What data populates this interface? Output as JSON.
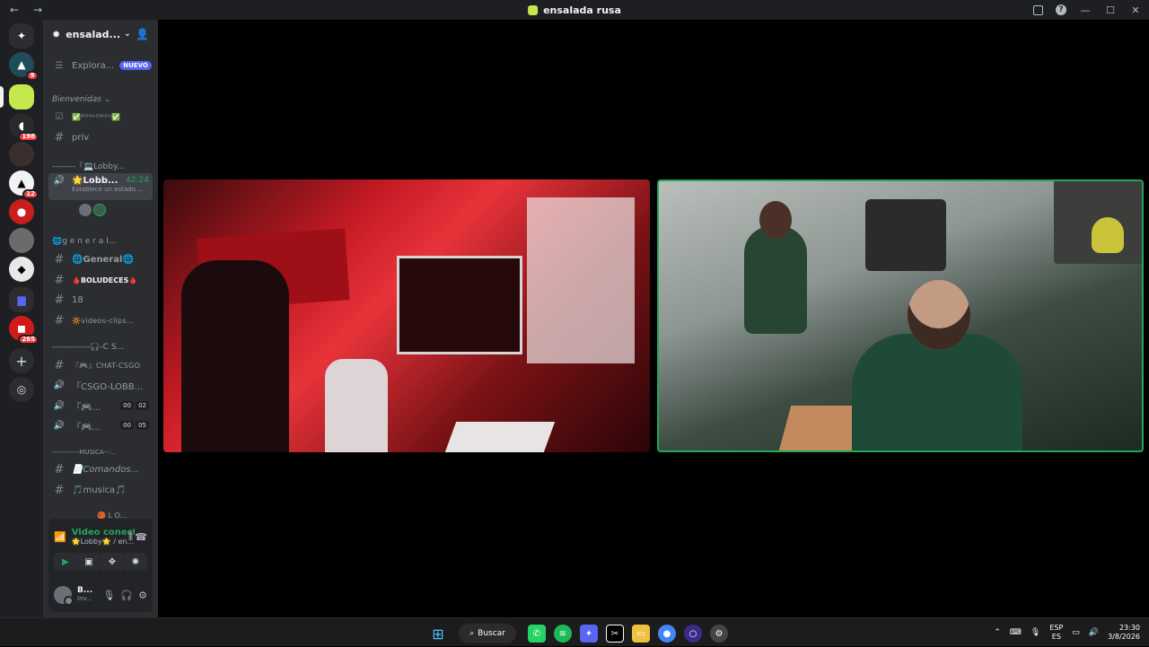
{
  "window": {
    "title": "ensalada rusa",
    "back": "←",
    "forward": "→"
  },
  "guilds": [
    {
      "name": "direct-messages",
      "icon": "discord-icon",
      "color": "#2b2d31"
    },
    {
      "name": "server-triangle",
      "badge": "9",
      "color": "#1f4c5a"
    },
    {
      "name": "server-ensalada",
      "color": "#c6e84f",
      "selected": true
    },
    {
      "name": "server-dark",
      "badge": "198",
      "color": "#2a2a2a"
    },
    {
      "name": "server-portrait",
      "color": "#3b2e2e"
    },
    {
      "name": "server-white",
      "badge": "12",
      "color": "#f2f3f5"
    },
    {
      "name": "server-red",
      "color": "#c81e1e"
    },
    {
      "name": "server-gray",
      "color": "#6b6b6b"
    },
    {
      "name": "server-penguin",
      "color": "#e8e8e8"
    },
    {
      "name": "folder",
      "color": "#5865f2"
    },
    {
      "name": "server-red-badge",
      "badge": "265",
      "color": "#d11b1b"
    }
  ],
  "server": {
    "name": "ensalad...",
    "explore_label": "Explora...",
    "explore_badge": "NUEVO"
  },
  "channels": {
    "cat_bienvenidas": "Bienvenidas ⌄",
    "ch_bienvenida": "✅ᴮᴵᴱᴺᵛᴱᴺᴵᴰᴬ✅",
    "ch_priv": "priv",
    "cat_lobby": "--------『💻Lobby...",
    "voice_lobby": "🌟Lobb...",
    "voice_lobby_time": "42:24",
    "voice_lobby_status": "Establece un estado ...",
    "cat_general": "🌐g e n e r a l...",
    "ch_general": "🌐General🌐",
    "ch_boludeces": "🩸BOLUDECES🩸",
    "ch_18": "18",
    "ch_videos": "🔆videos-clips...",
    "cat_csgo": "-------------🎧-C S...",
    "ch_chat_csgo": "『🎮』CHAT-CSGO",
    "voice_csgo_lobby": "『CSGO-LOBB...",
    "voice_a": "『🎮...",
    "voice_a_counts": [
      "00",
      "02"
    ],
    "voice_b": "『🎮...",
    "voice_b_counts": [
      "00",
      "05"
    ],
    "cat_musica": "------------MUSICA---...",
    "ch_comandos": "📄Comandos...",
    "ch_musica": "🎵musica🎵",
    "cat_lo": "🏀 L O..."
  },
  "voice_panel": {
    "status": "Video conectad",
    "channel": "🌟Lobby🌟 / en..."
  },
  "user": {
    "name": "B...",
    "status": "Inv..."
  },
  "taskbar": {
    "search": "Buscar",
    "lang_top": "ESP",
    "lang_bottom": "ES",
    "time": "23:30",
    "date": "3/8/2026"
  }
}
